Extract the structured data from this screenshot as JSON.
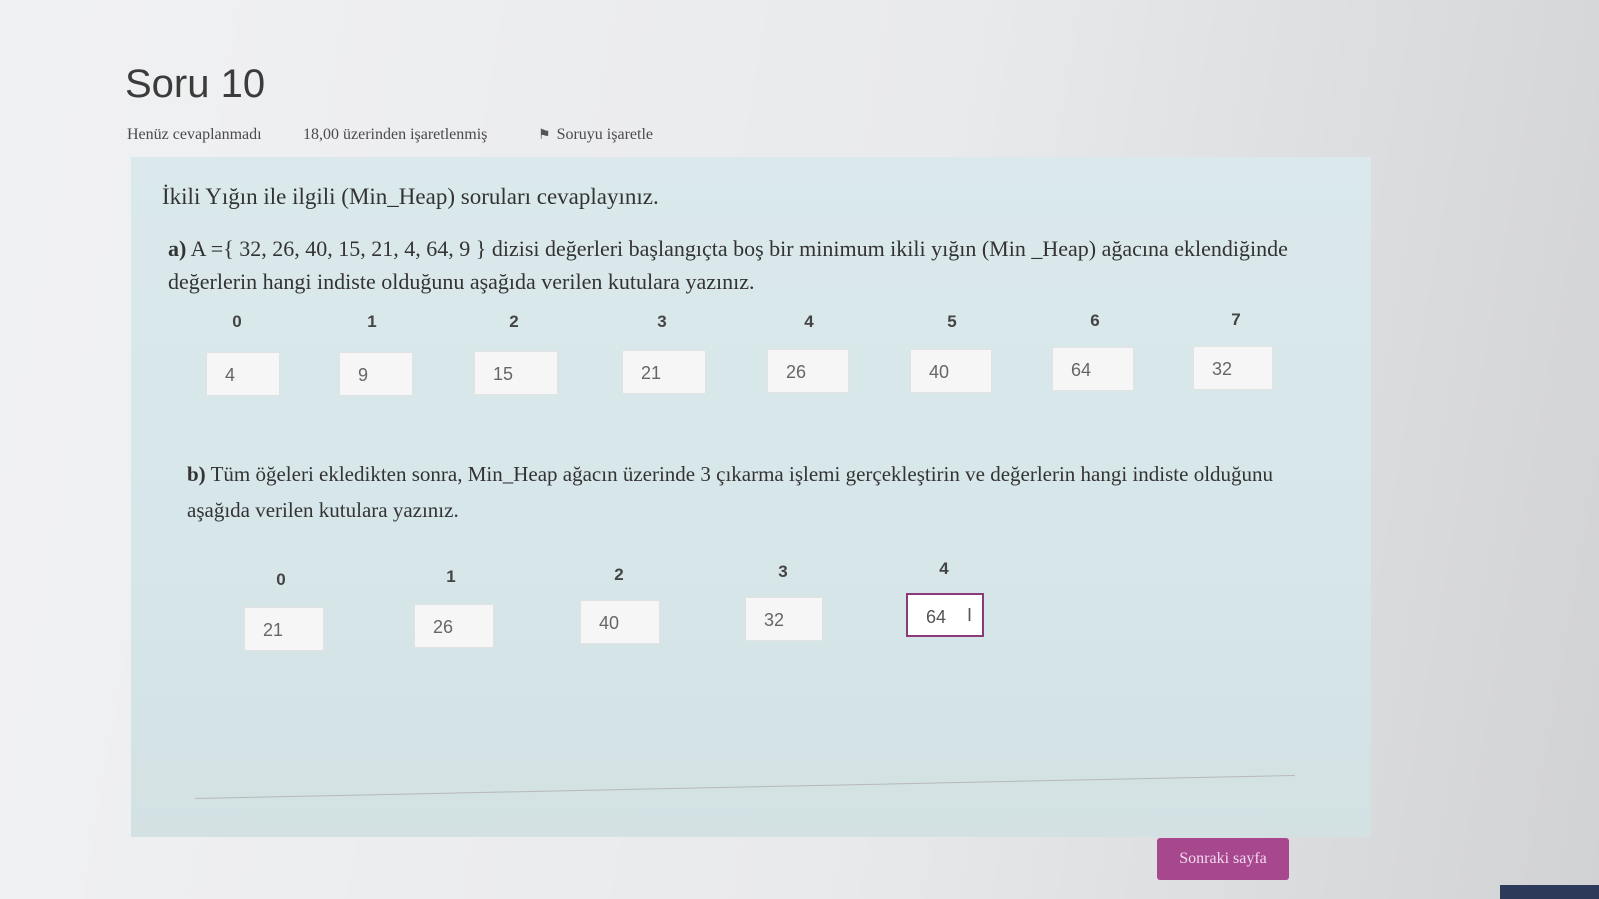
{
  "question": {
    "title": "Soru 10",
    "status": "Henüz cevaplanmadı",
    "grade": "18,00 üzerinden işaretlenmiş",
    "flag_label": "Soruyu işaretle"
  },
  "content": {
    "intro": "İkili Yığın ile ilgili (Min_Heap) soruları cevaplayınız.",
    "part_a": {
      "label": "a)",
      "text": "A ={ 32, 26, 40, 15, 21, 4, 64, 9 } dizisi değerleri başlangıçta boş bir minimum ikili yığın (Min _Heap) ağacına eklendiğinde değerlerin hangi indiste olduğunu aşağıda verilen kutulara yazınız.",
      "indices": [
        "0",
        "1",
        "2",
        "3",
        "4",
        "5",
        "6",
        "7"
      ],
      "values": [
        "4",
        "9",
        "15",
        "21",
        "26",
        "40",
        "64",
        "32"
      ]
    },
    "part_b": {
      "label": "b)",
      "text": "Tüm öğeleri ekledikten sonra, Min_Heap ağacın üzerinde 3 çıkarma işlemi gerçekleştirin ve değerlerin hangi indiste olduğunu aşağıda verilen kutulara yazınız.",
      "indices": [
        "0",
        "1",
        "2",
        "3",
        "4"
      ],
      "values": [
        "21",
        "26",
        "40",
        "32",
        "64"
      ]
    }
  },
  "footer": {
    "next_label": "Sonraki sayfa"
  },
  "colors": {
    "panel": "#d8e7ea",
    "accent": "#a7488f"
  },
  "icons": [
    "flag-icon",
    "text-cursor-icon"
  ]
}
